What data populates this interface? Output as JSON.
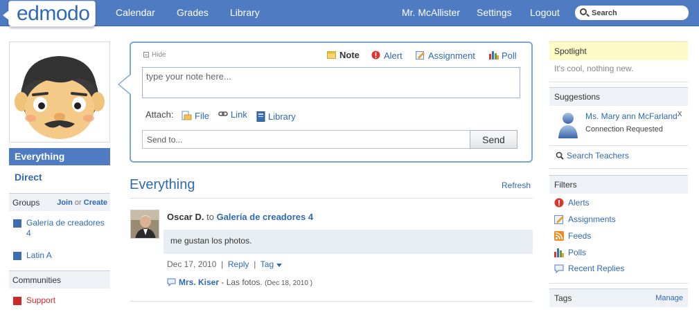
{
  "app": {
    "logo": "edmodo"
  },
  "topnav": {
    "calendar": "Calendar",
    "grades": "Grades",
    "library": "Library",
    "user": "Mr. McAllister",
    "settings": "Settings",
    "logout": "Logout",
    "search_placeholder": "Search"
  },
  "leftnav": {
    "everything": "Everything",
    "direct": "Direct",
    "groups_head": "Groups",
    "join": "Join",
    "or": "or",
    "create": "Create",
    "groups": [
      {
        "name": "Galería de creadores 4",
        "color": "#3c6eb0"
      },
      {
        "name": "Latin A",
        "color": "#3c6eb0"
      }
    ],
    "communities_head": "Communities",
    "communities": [
      {
        "name": "Support",
        "color": "#cc2929"
      }
    ]
  },
  "composer": {
    "hide": "Hide",
    "tabs": {
      "note": "Note",
      "alert": "Alert",
      "assignment": "Assignment",
      "poll": "Poll"
    },
    "note_placeholder": "type your note here...",
    "attach_label": "Attach:",
    "attach_file": "File",
    "attach_link": "Link",
    "attach_library": "Library",
    "sendto_placeholder": "Send to...",
    "send": "Send"
  },
  "feed": {
    "title": "Everything",
    "refresh": "Refresh",
    "post": {
      "author": "Oscar D.",
      "to": "to",
      "group": "Galería de creadores 4",
      "body": "me gustan los photos.",
      "date": "Dec 17, 2010",
      "sep1": "|",
      "reply": "Reply",
      "sep2": "|",
      "tag": "Tag",
      "reply_author": "Mrs. Kiser",
      "reply_text": "- Las fotos.",
      "reply_date": "(Dec 18, 2010 )"
    }
  },
  "right": {
    "spotlight_head": "Spotlight",
    "spotlight_text": "It's cool, nothing new.",
    "suggestions_head": "Suggestions",
    "suggestion_name": "Ms. Mary ann McFarland",
    "suggestion_status": "Connection Requested",
    "close": "x",
    "search_teachers": "Search Teachers",
    "filters_head": "Filters",
    "filters": [
      "Alerts",
      "Assignments",
      "Feeds",
      "Polls",
      "Recent Replies"
    ],
    "tags_head": "Tags",
    "manage": "Manage"
  },
  "colors": {
    "topbar": "#4f7bc2",
    "link": "#2f69b4",
    "spotlight_bg": "#fcfbc8"
  }
}
